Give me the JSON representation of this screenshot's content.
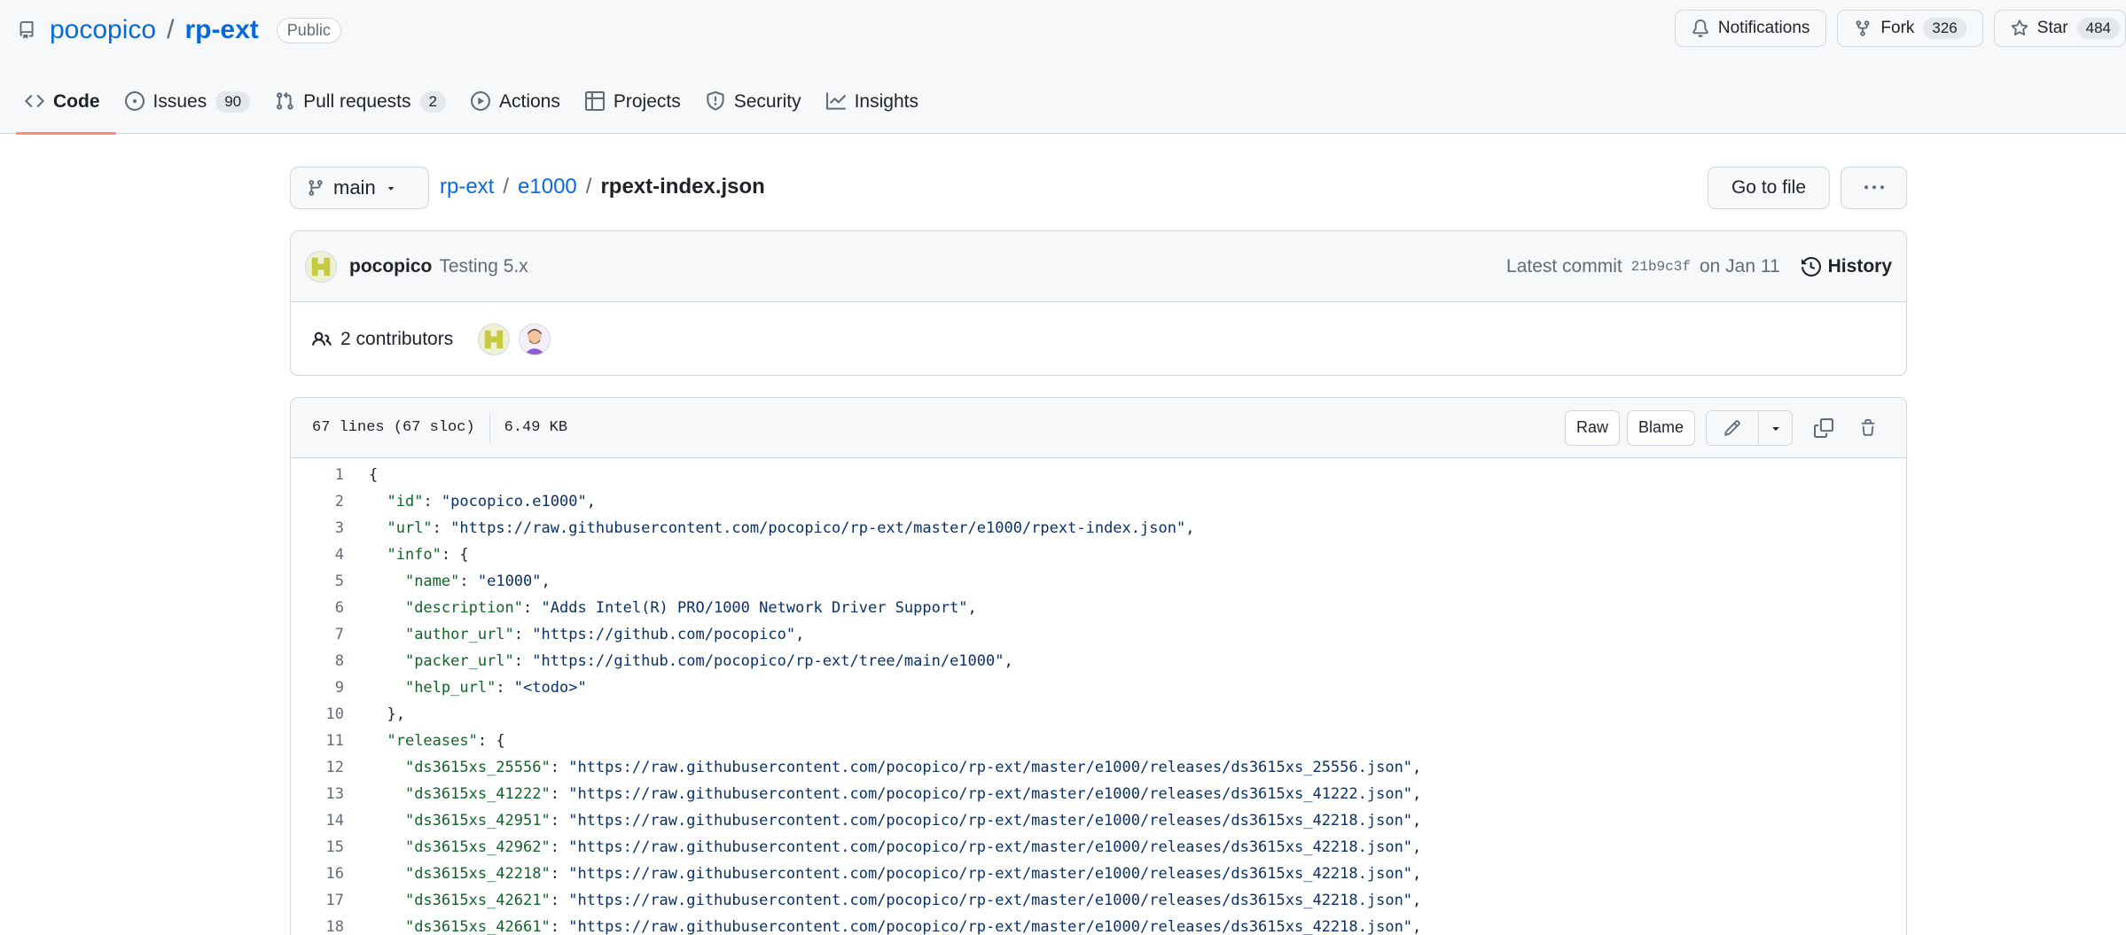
{
  "repo": {
    "owner": "pocopico",
    "separator": "/",
    "name": "rp-ext",
    "visibility": "Public"
  },
  "header_buttons": {
    "notifications": "Notifications",
    "fork": "Fork",
    "fork_count": "326",
    "star": "Star",
    "star_count": "484"
  },
  "tabs": [
    {
      "label": "Code",
      "icon": "code-icon",
      "active": true
    },
    {
      "label": "Issues",
      "icon": "issue-icon",
      "count": "90"
    },
    {
      "label": "Pull requests",
      "icon": "pull-request-icon",
      "count": "2"
    },
    {
      "label": "Actions",
      "icon": "play-icon"
    },
    {
      "label": "Projects",
      "icon": "table-icon"
    },
    {
      "label": "Security",
      "icon": "shield-icon"
    },
    {
      "label": "Insights",
      "icon": "graph-icon"
    }
  ],
  "file_nav": {
    "branch": "main",
    "breadcrumb": [
      {
        "label": "rp-ext"
      },
      {
        "label": "e1000"
      }
    ],
    "crumb_sep": "/",
    "filename": "rpext-index.json",
    "go_to_file": "Go to file"
  },
  "commit": {
    "author": "pocopico",
    "message": "Testing 5.x",
    "latest_label": "Latest commit",
    "sha": "21b9c3f",
    "date": "on Jan 11",
    "history": "History"
  },
  "contributors": {
    "label": "2 contributors"
  },
  "file_info": {
    "lines": "67 lines (67 sloc)",
    "size": "6.49 KB",
    "raw": "Raw",
    "blame": "Blame"
  },
  "code_lines": [
    {
      "n": "1",
      "pre": "{",
      "key": "",
      "mid": "",
      "val": "",
      "post": ""
    },
    {
      "n": "2",
      "pre": "  ",
      "key": "\"id\"",
      "mid": ": ",
      "val": "\"pocopico.e1000\"",
      "post": ","
    },
    {
      "n": "3",
      "pre": "  ",
      "key": "\"url\"",
      "mid": ": ",
      "val": "\"https://raw.githubusercontent.com/pocopico/rp-ext/master/e1000/rpext-index.json\"",
      "post": ","
    },
    {
      "n": "4",
      "pre": "  ",
      "key": "\"info\"",
      "mid": ": {",
      "val": "",
      "post": ""
    },
    {
      "n": "5",
      "pre": "    ",
      "key": "\"name\"",
      "mid": ": ",
      "val": "\"e1000\"",
      "post": ","
    },
    {
      "n": "6",
      "pre": "    ",
      "key": "\"description\"",
      "mid": ": ",
      "val": "\"Adds Intel(R) PRO/1000 Network Driver Support\"",
      "post": ","
    },
    {
      "n": "7",
      "pre": "    ",
      "key": "\"author_url\"",
      "mid": ": ",
      "val": "\"https://github.com/pocopico\"",
      "post": ","
    },
    {
      "n": "8",
      "pre": "    ",
      "key": "\"packer_url\"",
      "mid": ": ",
      "val": "\"https://github.com/pocopico/rp-ext/tree/main/e1000\"",
      "post": ","
    },
    {
      "n": "9",
      "pre": "    ",
      "key": "\"help_url\"",
      "mid": ": ",
      "val": "\"<todo>\"",
      "post": ""
    },
    {
      "n": "10",
      "pre": "  },",
      "key": "",
      "mid": "",
      "val": "",
      "post": ""
    },
    {
      "n": "11",
      "pre": "  ",
      "key": "\"releases\"",
      "mid": ": {",
      "val": "",
      "post": ""
    },
    {
      "n": "12",
      "pre": "    ",
      "key": "\"ds3615xs_25556\"",
      "mid": ": ",
      "val": "\"https://raw.githubusercontent.com/pocopico/rp-ext/master/e1000/releases/ds3615xs_25556.json\"",
      "post": ","
    },
    {
      "n": "13",
      "pre": "    ",
      "key": "\"ds3615xs_41222\"",
      "mid": ": ",
      "val": "\"https://raw.githubusercontent.com/pocopico/rp-ext/master/e1000/releases/ds3615xs_41222.json\"",
      "post": ","
    },
    {
      "n": "14",
      "pre": "    ",
      "key": "\"ds3615xs_42951\"",
      "mid": ": ",
      "val": "\"https://raw.githubusercontent.com/pocopico/rp-ext/master/e1000/releases/ds3615xs_42218.json\"",
      "post": ","
    },
    {
      "n": "15",
      "pre": "    ",
      "key": "\"ds3615xs_42962\"",
      "mid": ": ",
      "val": "\"https://raw.githubusercontent.com/pocopico/rp-ext/master/e1000/releases/ds3615xs_42218.json\"",
      "post": ","
    },
    {
      "n": "16",
      "pre": "    ",
      "key": "\"ds3615xs_42218\"",
      "mid": ": ",
      "val": "\"https://raw.githubusercontent.com/pocopico/rp-ext/master/e1000/releases/ds3615xs_42218.json\"",
      "post": ","
    },
    {
      "n": "17",
      "pre": "    ",
      "key": "\"ds3615xs_42621\"",
      "mid": ": ",
      "val": "\"https://raw.githubusercontent.com/pocopico/rp-ext/master/e1000/releases/ds3615xs_42218.json\"",
      "post": ","
    },
    {
      "n": "18",
      "pre": "    ",
      "key": "\"ds3615xs_42661\"",
      "mid": ": ",
      "val": "\"https://raw.githubusercontent.com/pocopico/rp-ext/master/e1000/releases/ds3615xs_42218.json\"",
      "post": ","
    }
  ],
  "colors": {
    "link": "#0969da",
    "tab_underline": "#fd8c73",
    "json_key": "#116329",
    "json_string": "#0a3069"
  }
}
